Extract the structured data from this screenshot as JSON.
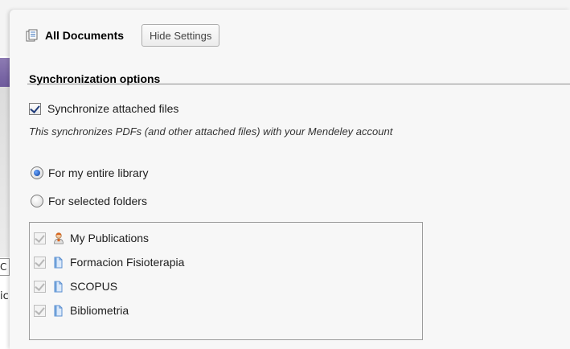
{
  "background": {
    "field_text": "C",
    "label_text": "ic"
  },
  "header": {
    "title": "All Documents",
    "hide_settings_label": "Hide Settings",
    "icon": "documents-icon"
  },
  "sync": {
    "section_title": "Synchronization options",
    "attach_label": "Synchronize attached files",
    "attach_checked": true,
    "description": "This synchronizes PDFs (and other attached files) with your Mendeley account",
    "radio_entire": "For my entire library",
    "radio_selected": "For selected folders",
    "selected_option": "entire",
    "folders": [
      {
        "label": "My Publications",
        "icon": "person-icon",
        "checked": true
      },
      {
        "label": "Formacion Fisioterapia",
        "icon": "folder-icon",
        "checked": true
      },
      {
        "label": "SCOPUS",
        "icon": "folder-icon",
        "checked": true
      },
      {
        "label": "Bibliometria",
        "icon": "folder-icon",
        "checked": true
      }
    ]
  },
  "colors": {
    "accent": "#0f3f9a",
    "folder_blue": "#6b9fd9",
    "background_purple": "#7a67a6"
  }
}
